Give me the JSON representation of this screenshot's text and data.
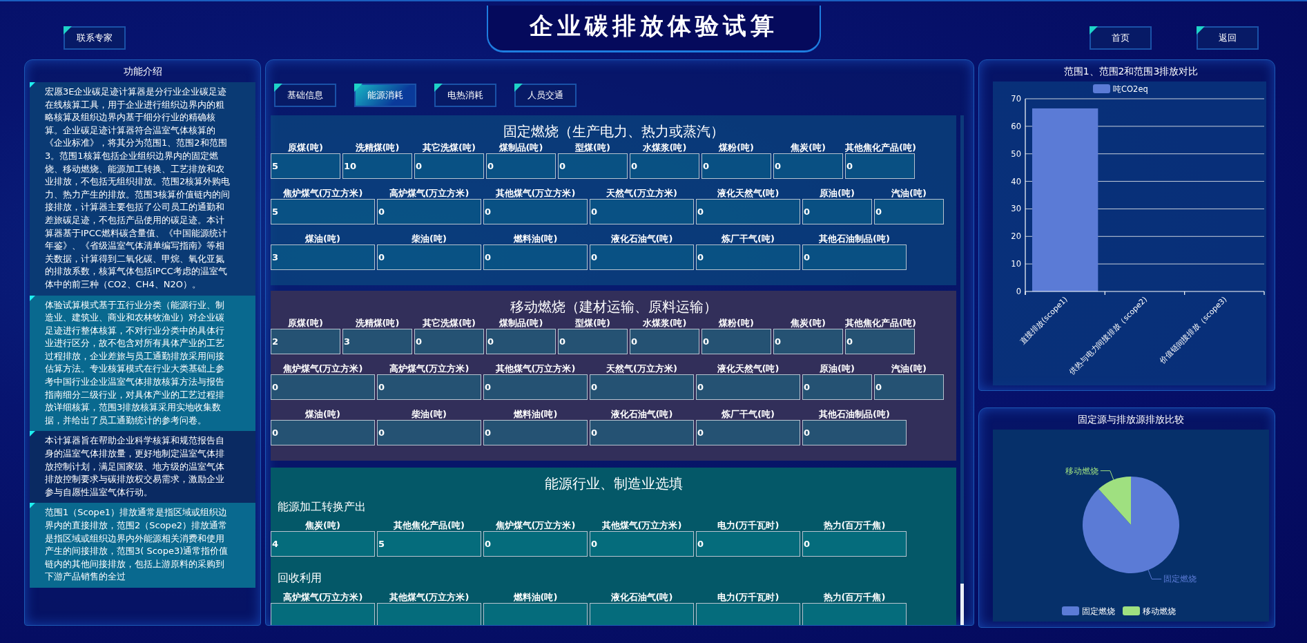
{
  "header": {
    "title": "企业碳排放体验试算",
    "left_buttons": [
      {
        "label": "联系专家"
      }
    ],
    "right_buttons": [
      {
        "label": "首页"
      },
      {
        "label": "返回"
      }
    ]
  },
  "intro": {
    "title": "功能介绍",
    "paragraphs": [
      "宏愿3E企业碳足迹计算器是分行业企业碳足迹在线核算工具，用于企业进行组织边界内的粗略核算及组织边界内基于细分行业的精确核算。企业碳足迹计算器符合温室气体核算的《企业标准》，将其分为范围1、范围2和范围3。范围1核算包括企业组织边界内的固定燃烧、移动燃烧、能源加工转换、工艺排放和农业排放，不包括无组织排放。范围2核算外购电力、热力产生的排放。范围3核算价值链内的间接排放，计算器主要包括了公司员工的通勤和差旅碳足迹，不包括产品使用的碳足迹。本计算器基于IPCC燃料碳含量值、《中国能源统计年鉴》、《省级温室气体清单编写指南》等相关数据，计算得到二氧化碳、甲烷、氧化亚氮的排放系数，核算气体包括IPCC考虑的温室气体中的前三种（CO2、CH4、N2O）。",
      "体验试算模式基于五行业分类（能源行业、制造业、建筑业、商业和农林牧渔业）对企业碳足迹进行整体核算，不对行业分类中的具体行业进行区分，故不包含对所有具体产业的工艺过程排放，企业差旅与员工通勤排放采用间接估算方法。专业核算模式在行业大类基础上参考中国行业企业温室气体排放核算方法与报告指南细分二级行业，对具体产业的工艺过程排放详细核算，范围3排放核算采用实地收集数据，并给出了员工通勤统计的参考问卷。",
      "本计算器旨在帮助企业科学核算和规范报告自身的温室气体排放量，更好地制定温室气体排放控制计划，满足国家级、地方级的温室气体排放控制要求与碳排放权交易需求，激励企业参与自愿性温室气体行动。",
      "范围1（Scope1）排放通常是指区域或组织边界内的直接排放，范围2（Scope2）排放通常是指区域或组织边界内外能源相关消费和使用产生的间接排放，范围3( Scope3)通常指价值链内的其他间接排放，包括上游原料的采购到下游产品销售的全过"
    ]
  },
  "calculator": {
    "tabs": [
      {
        "label": "基础信息",
        "selected": false
      },
      {
        "label": "能源消耗",
        "selected": true
      },
      {
        "label": "电热消耗",
        "selected": false
      },
      {
        "label": "人员交通",
        "selected": false
      }
    ],
    "sections": [
      {
        "title": "固定燃烧（生产电力、热力或蒸汽）",
        "lines": [
          {
            "kind": "fields",
            "fields": [
              {
                "label": "原煤(吨)",
                "value": "5"
              },
              {
                "label": "洗精煤(吨)",
                "value": "10"
              },
              {
                "label": "其它洗煤(吨)",
                "value": "0"
              },
              {
                "label": "煤制品(吨)",
                "value": "0"
              },
              {
                "label": "型煤(吨)",
                "value": "0"
              },
              {
                "label": "水煤浆(吨)",
                "value": "0"
              },
              {
                "label": "煤粉(吨)",
                "value": "0"
              },
              {
                "label": "焦炭(吨)",
                "value": "0"
              },
              {
                "label": "其他焦化产品(吨)",
                "value": "0"
              }
            ]
          },
          {
            "kind": "fields",
            "fields": [
              {
                "label": "焦炉煤气(万立方米)",
                "value": "5"
              },
              {
                "label": "高炉煤气(万立方米)",
                "value": "0"
              },
              {
                "label": "其他煤气(万立方米)",
                "value": "0"
              },
              {
                "label": "天然气(万立方米)",
                "value": "0"
              },
              {
                "label": "液化天然气(吨)",
                "value": "0"
              },
              {
                "label": "原油(吨)",
                "value": "0"
              },
              {
                "label": "汽油(吨)",
                "value": "0"
              }
            ]
          },
          {
            "kind": "fields",
            "fields": [
              {
                "label": "煤油(吨)",
                "value": "3"
              },
              {
                "label": "柴油(吨)",
                "value": "0"
              },
              {
                "label": "燃料油(吨)",
                "value": "0"
              },
              {
                "label": "液化石油气(吨)",
                "value": "0"
              },
              {
                "label": "炼厂干气(吨)",
                "value": "0"
              },
              {
                "label": "其他石油制品(吨)",
                "value": "0"
              }
            ]
          }
        ]
      },
      {
        "title": "移动燃烧（建材运输、原料运输）",
        "lines": [
          {
            "kind": "fields",
            "fields": [
              {
                "label": "原煤(吨)",
                "value": "2"
              },
              {
                "label": "洗精煤(吨)",
                "value": "3"
              },
              {
                "label": "其它洗煤(吨)",
                "value": "0"
              },
              {
                "label": "煤制品(吨)",
                "value": "0"
              },
              {
                "label": "型煤(吨)",
                "value": "0"
              },
              {
                "label": "水煤浆(吨)",
                "value": "0"
              },
              {
                "label": "煤粉(吨)",
                "value": "0"
              },
              {
                "label": "焦炭(吨)",
                "value": "0"
              },
              {
                "label": "其他焦化产品(吨)",
                "value": "0"
              }
            ]
          },
          {
            "kind": "fields",
            "fields": [
              {
                "label": "焦炉煤气(万立方米)",
                "value": "0"
              },
              {
                "label": "高炉煤气(万立方米)",
                "value": "0"
              },
              {
                "label": "其他煤气(万立方米)",
                "value": "0"
              },
              {
                "label": "天然气(万立方米)",
                "value": "0"
              },
              {
                "label": "液化天然气(吨)",
                "value": "0"
              },
              {
                "label": "原油(吨)",
                "value": "0"
              },
              {
                "label": "汽油(吨)",
                "value": "0"
              }
            ]
          },
          {
            "kind": "fields",
            "fields": [
              {
                "label": "煤油(吨)",
                "value": "0"
              },
              {
                "label": "柴油(吨)",
                "value": "0"
              },
              {
                "label": "燃料油(吨)",
                "value": "0"
              },
              {
                "label": "液化石油气(吨)",
                "value": "0"
              },
              {
                "label": "炼厂干气(吨)",
                "value": "0"
              },
              {
                "label": "其他石油制品(吨)",
                "value": "0"
              }
            ]
          }
        ]
      },
      {
        "title": "能源行业、制造业选填",
        "lines": [
          {
            "kind": "subtitle",
            "text": "能源加工转换产出"
          },
          {
            "kind": "fields",
            "fields": [
              {
                "label": "焦炭(吨)",
                "value": "4"
              },
              {
                "label": "其他焦化产品(吨)",
                "value": "5"
              },
              {
                "label": "焦炉煤气(万立方米)",
                "value": "0"
              },
              {
                "label": "其他煤气(万立方米)",
                "value": "0"
              },
              {
                "label": "电力(万千瓦时)",
                "value": "0"
              },
              {
                "label": "热力(百万千焦)",
                "value": "0"
              }
            ]
          },
          {
            "kind": "subtitle",
            "text": "回收利用"
          },
          {
            "kind": "fields",
            "fields": [
              {
                "label": "高炉煤气(万立方米)"
              },
              {
                "label": "其他煤气(万立方米)"
              },
              {
                "label": "燃料油(吨)"
              },
              {
                "label": "液化石油气(吨)"
              },
              {
                "label": "电力(万千瓦时)"
              },
              {
                "label": "热力(百万千焦)"
              }
            ]
          }
        ]
      }
    ]
  },
  "scope_chart": {
    "title": "范围1、范围2和范围3排放对比",
    "chart_data": {
      "type": "bar",
      "categories": [
        "直接排放(scope1)",
        "供热与电力间接排放（scope2)",
        "价值链间接排放（scope3)"
      ],
      "series": [
        {
          "name": "吨CO2eq",
          "color": "#5b7bd6",
          "values": [
            66.5,
            0,
            0
          ]
        }
      ],
      "ylim": [
        0,
        70
      ],
      "yticks": [
        0,
        10,
        20,
        30,
        40,
        50,
        60,
        70
      ],
      "grid": true
    }
  },
  "source_chart": {
    "title": "固定源与排放源排放比较",
    "slices": [
      {
        "label": "固定燃烧",
        "color": "#5b7bd6"
      },
      {
        "label": "移动燃烧",
        "color": "#9fe080"
      }
    ],
    "legend": [
      {
        "label": "固定燃烧",
        "color": "#5b7bd6"
      },
      {
        "label": "移动燃烧",
        "color": "#9fe080"
      }
    ]
  }
}
